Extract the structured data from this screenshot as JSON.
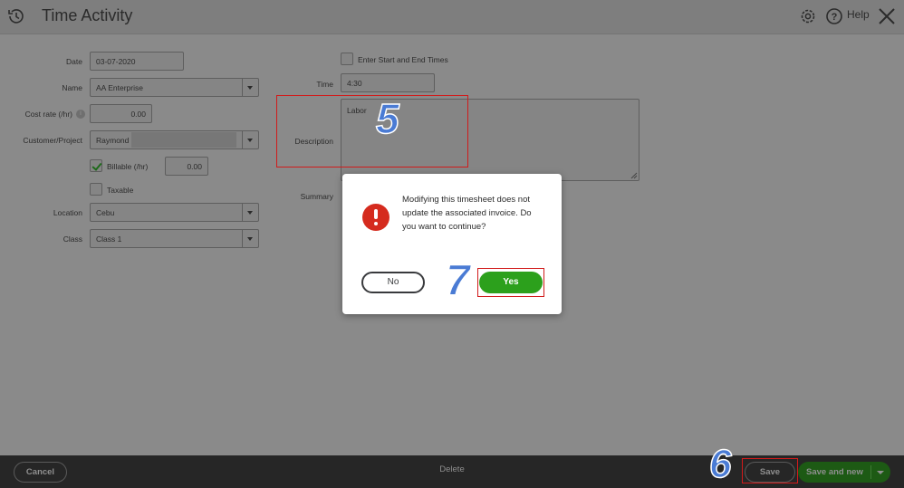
{
  "header": {
    "title": "Time Activity",
    "help_label": "Help"
  },
  "form": {
    "date": {
      "label": "Date",
      "value": "03-07-2020"
    },
    "name": {
      "label": "Name",
      "value": "AA Enterprise"
    },
    "cost_rate": {
      "label": "Cost rate (/hr)",
      "value": "0.00"
    },
    "customer_project": {
      "label": "Customer/Project",
      "value": "Raymond"
    },
    "billable": {
      "label": "Billable (/hr)",
      "checked": true,
      "value": "0.00"
    },
    "taxable": {
      "label": "Taxable",
      "checked": false
    },
    "location": {
      "label": "Location",
      "value": "Cebu"
    },
    "class": {
      "label": "Class",
      "value": "Class 1"
    },
    "start_end_times": {
      "label": "Enter Start and End Times",
      "checked": false
    },
    "time": {
      "label": "Time",
      "value": "4:30"
    },
    "description": {
      "label": "Description",
      "value": "Labor"
    },
    "summary": {
      "label": "Summary"
    }
  },
  "modal": {
    "message": "Modifying this timesheet does not update the associated invoice. Do you want to continue?",
    "no_label": "No",
    "yes_label": "Yes"
  },
  "footer": {
    "cancel_label": "Cancel",
    "delete_label": "Delete",
    "save_label": "Save",
    "save_and_new_label": "Save and new"
  },
  "annotations": {
    "step_description": "5",
    "step_save": "6",
    "step_yes": "7"
  },
  "colors": {
    "overlay_gray": "#8a8a8a",
    "footer_bg": "#262626",
    "accent_green": "#2ca01c",
    "alert_red": "#d52b1e",
    "annotation_red": "#d11b1b",
    "annotation_blue": "#4a7bd4"
  }
}
